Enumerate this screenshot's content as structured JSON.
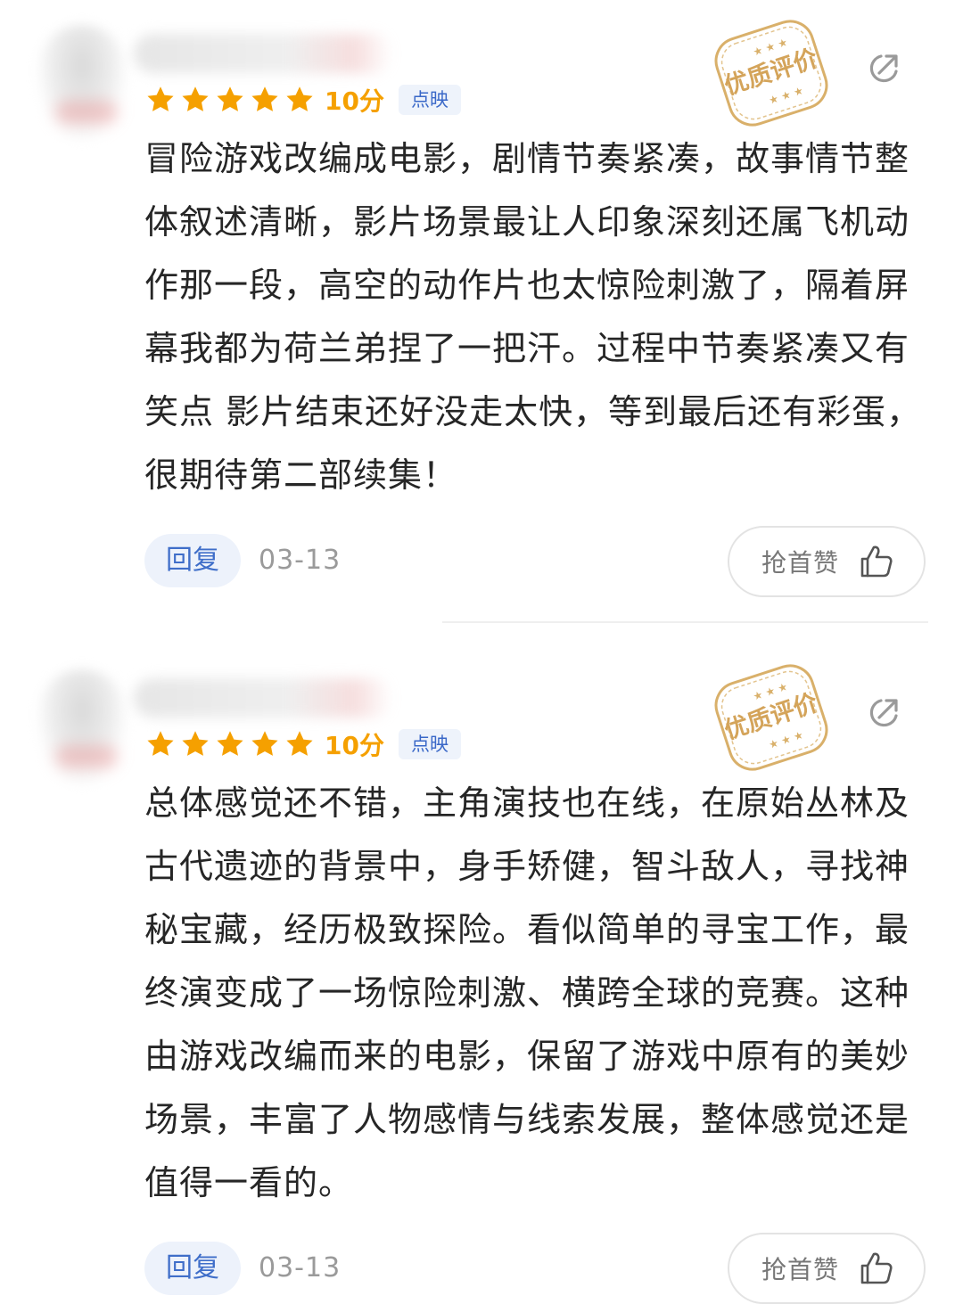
{
  "reviews": [
    {
      "score": "10分",
      "tag": "点映",
      "badge": "优质评价",
      "content": "冒险游戏改编成电影，剧情节奏紧凑，故事情节整体叙述清晰，影片场景最让人印象深刻还属飞机动作那一段，高空的动作片也太惊险刺激了，隔着屏幕我都为荷兰弟捏了一把汗。过程中节奏紧凑又有笑点 影片结束还好没走太快，等到最后还有彩蛋，很期待第二部续集！",
      "reply": "回复",
      "date": "03-13",
      "like": "抢首赞"
    },
    {
      "score": "10分",
      "tag": "点映",
      "badge": "优质评价",
      "content": "总体感觉还不错，主角演技也在线，在原始丛林及古代遗迹的背景中，身手矫健，智斗敌人，寻找神秘宝藏，经历极致探险。看似简单的寻宝工作，最终演变成了一场惊险刺激、横跨全球的竞赛。这种由游戏改编而来的电影，保留了游戏中原有的美妙场景，丰富了人物感情与线索发展，整体感觉还是值得一看的。",
      "reply": "回复",
      "date": "03-13",
      "like": "抢首赞"
    }
  ],
  "colors": {
    "star": "#f5a000",
    "link": "#3f6ec9",
    "badge": "#d9b06a"
  },
  "icons": {
    "star": "star-icon",
    "share": "share-icon",
    "like": "thumbs-up-icon",
    "badge": "quality-review-stamp-icon"
  }
}
